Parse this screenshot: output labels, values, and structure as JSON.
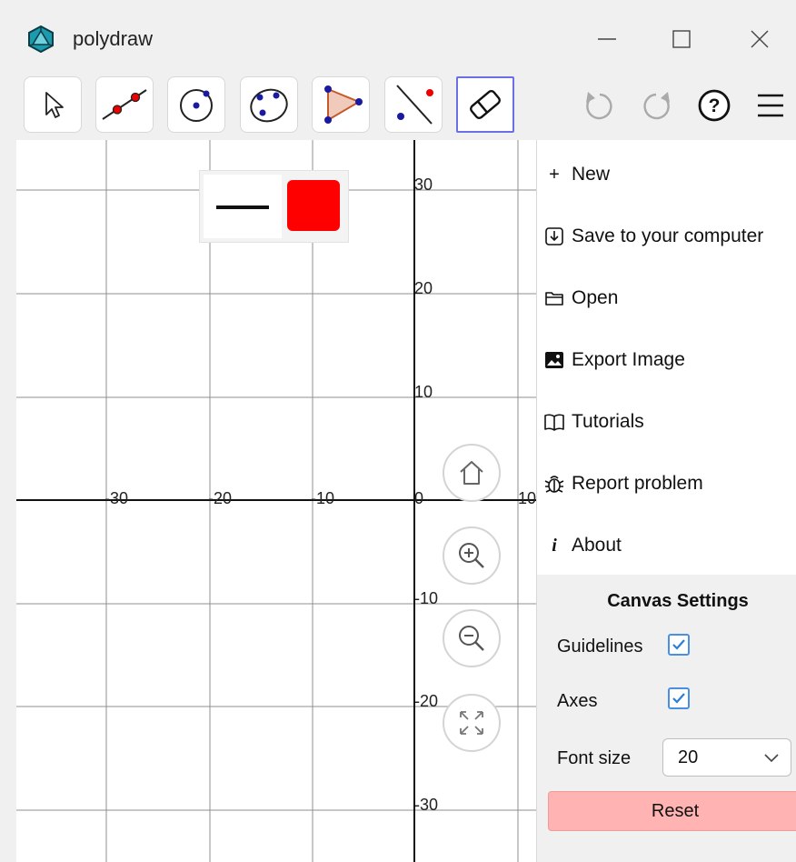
{
  "app": {
    "title": "polydraw"
  },
  "toolbar": {
    "tools": [
      "select-tool",
      "line-tool",
      "circle-center-tool",
      "circle-points-tool",
      "polygon-tool",
      "perpendicular-tool",
      "eraser-tool"
    ],
    "active_tool": "eraser-tool",
    "right_icons": [
      "undo-icon",
      "redo-icon",
      "help-icon",
      "menu-icon"
    ]
  },
  "canvas": {
    "x_ticks": [
      "-30",
      "-20",
      "-10",
      "0",
      "10"
    ],
    "y_ticks": [
      "30",
      "20",
      "10",
      "-10",
      "-20",
      "-30"
    ],
    "style_popup": {
      "line_style": "solid",
      "color": "#ff0000"
    },
    "zoom_controls": [
      "home-icon",
      "zoom-in-icon",
      "zoom-out-icon",
      "fullscreen-icon"
    ]
  },
  "menu": {
    "items": [
      {
        "icon": "plus-icon",
        "glyph": "+",
        "label": "New"
      },
      {
        "icon": "download-icon",
        "glyph": "",
        "label": "Save to your computer"
      },
      {
        "icon": "folder-icon",
        "glyph": "",
        "label": "Open"
      },
      {
        "icon": "image-icon",
        "glyph": "",
        "label": "Export Image"
      },
      {
        "icon": "book-icon",
        "glyph": "",
        "label": "Tutorials"
      },
      {
        "icon": "bug-icon",
        "glyph": "",
        "label": "Report problem"
      },
      {
        "icon": "info-icon",
        "glyph": "i",
        "label": "About"
      }
    ]
  },
  "settings": {
    "title": "Canvas Settings",
    "guidelines_label": "Guidelines",
    "guidelines_checked": true,
    "axes_label": "Axes",
    "axes_checked": true,
    "font_size_label": "Font size",
    "font_size_value": "20",
    "reset_label": "Reset"
  }
}
